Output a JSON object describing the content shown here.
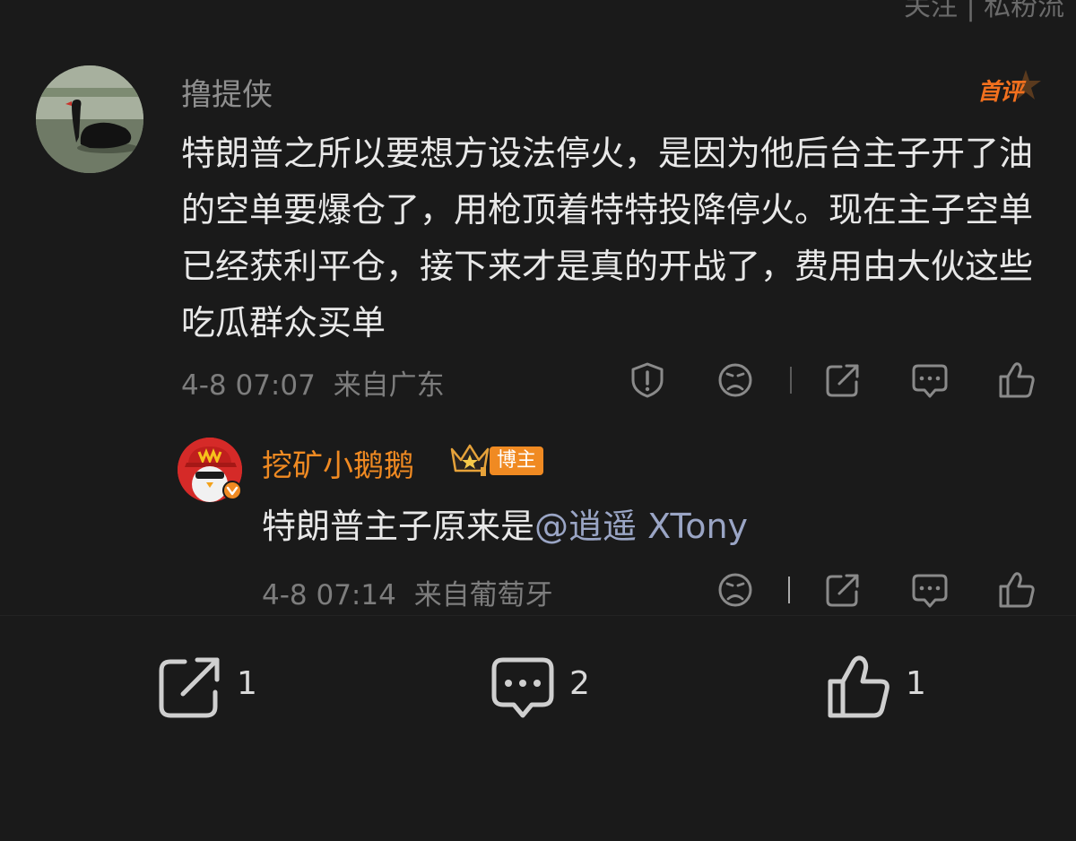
{
  "top_partial_text": "关注 | 私粉流",
  "comment": {
    "username": "撸提侠",
    "first_badge": "首评",
    "text": "特朗普之所以要想方设法停火，是因为他后台主子开了油的空单要爆仓了，用枪顶着特特投降停火。现在主子空单已经获利平仓，接下来才是真的开战了，费用由大伙这些吃瓜群众买单",
    "time": "4-8 07:07",
    "location": "来自广东",
    "icons": [
      "report-icon",
      "dislike-face-icon",
      "share-icon",
      "comment-icon",
      "like-icon"
    ]
  },
  "reply": {
    "username": "挖矿小鹅鹅",
    "badge": "博主",
    "text_prefix": "特朗普主子原来是",
    "mention": "@逍遥 XTony",
    "time": "4-8 07:14",
    "location": "来自葡萄牙",
    "icons": [
      "dislike-face-icon",
      "share-icon",
      "comment-icon",
      "like-icon"
    ]
  },
  "bottom_bar": {
    "share_count": "1",
    "comment_count": "2",
    "like_count": "1"
  },
  "colors": {
    "background": "#1a1a1a",
    "text_primary": "#e8e8e8",
    "text_secondary": "#7d7d7d",
    "accent_orange": "#f08a22",
    "mention_blue": "#9aa5c5"
  }
}
